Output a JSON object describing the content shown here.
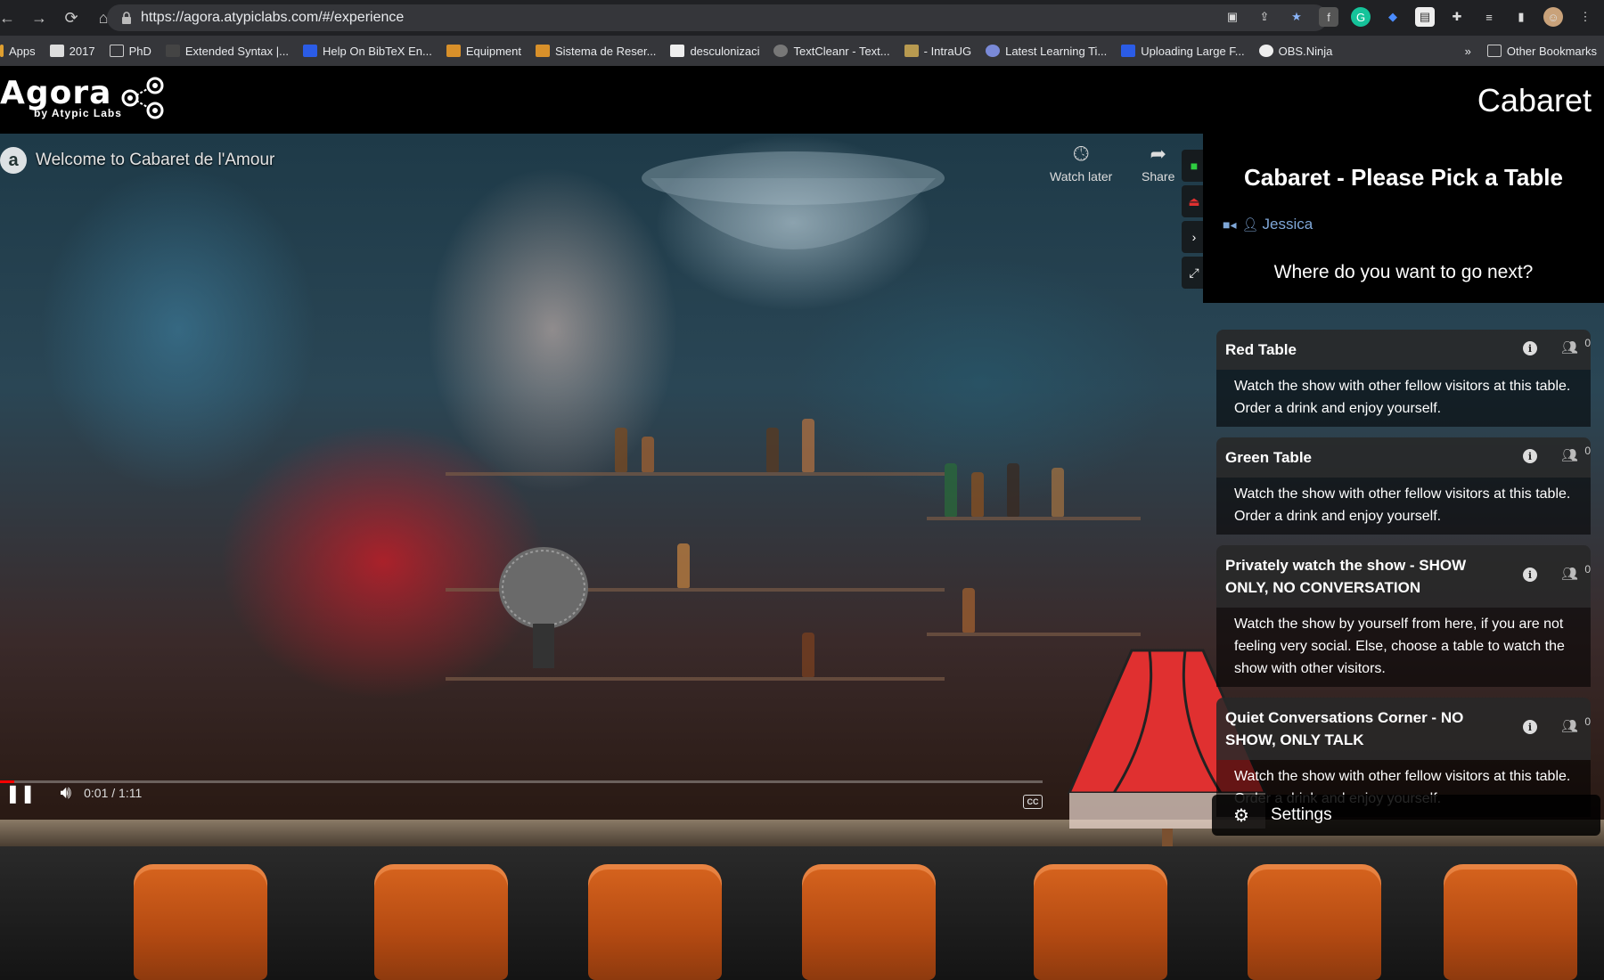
{
  "browser": {
    "url": "https://agora.atypiclabs.com/#/experience",
    "bookmarks": [
      "Apps",
      "2017",
      "PhD",
      "Extended Syntax |...",
      "Help On BibTeX En...",
      "Equipment",
      "Sistema de Reser...",
      "desculonizaci",
      "TextCleanr - Text...",
      "- IntraUG",
      "Latest Learning Ti...",
      "Uploading Large F...",
      "OBS.Ninja"
    ],
    "bookmarks_more": "»",
    "other_bookmarks": "Other Bookmarks"
  },
  "app": {
    "logo": "Agora",
    "logo_sub": "by Atypic Labs",
    "room_title": "Cabaret"
  },
  "video": {
    "channel_letter": "a",
    "title": "Welcome to Cabaret de l'Amour",
    "watch_later": "Watch later",
    "share": "Share",
    "time": "0:01 / 1:11",
    "progress": 0.014,
    "cc": "CC"
  },
  "panel": {
    "title": "Cabaret - Please Pick a Table",
    "user": "Jessica",
    "question": "Where do you want to go next?",
    "tables": [
      {
        "name": "Red Table",
        "count": "0",
        "description": "Watch the show with other fellow visitors at this table. Order a drink and enjoy yourself."
      },
      {
        "name": "Green Table",
        "count": "0",
        "description": "Watch the show with other fellow visitors at this table. Order a drink and enjoy yourself."
      },
      {
        "name": "Privately watch the show - SHOW ONLY, NO CONVERSATION",
        "count": "0",
        "description": "Watch the show by yourself from here, if you are not feeling very social. Else, choose a table to watch the show with other visitors."
      },
      {
        "name": "Quiet Conversations Corner - NO SHOW, ONLY TALK",
        "count": "0",
        "description": "Watch the show with other fellow visitors at this table. Order a drink and enjoy yourself."
      }
    ],
    "settings": "Settings"
  },
  "colors": {
    "accent_user": "#7fa7d8",
    "progress": "#ff0000",
    "stool": "#d7641e"
  }
}
